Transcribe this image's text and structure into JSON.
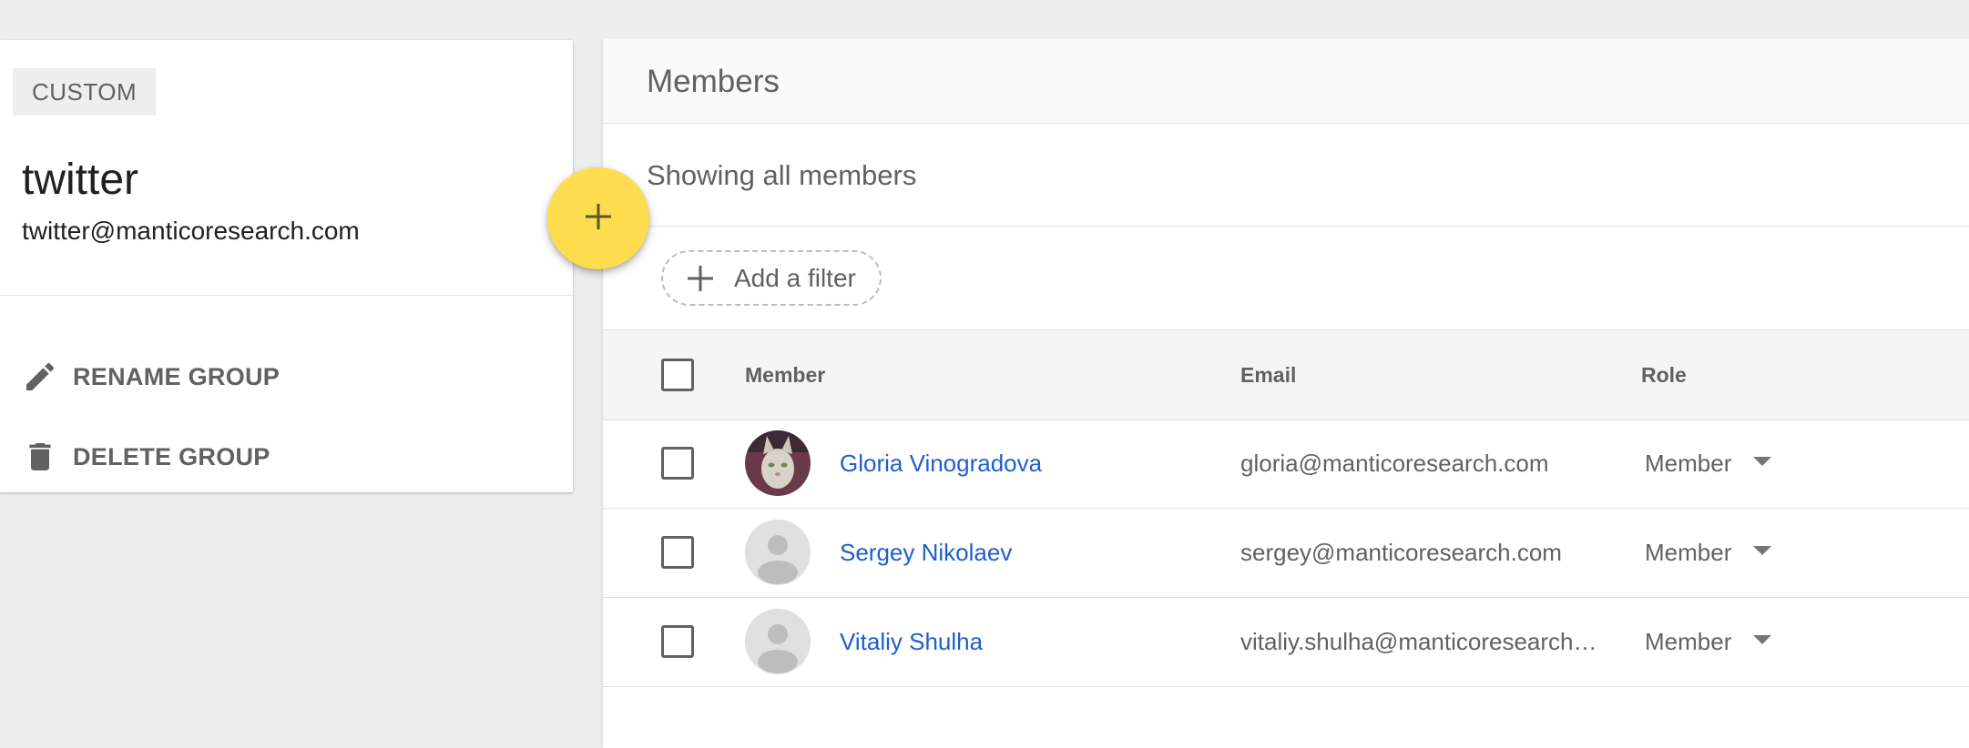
{
  "group": {
    "chip": "CUSTOM",
    "name": "twitter",
    "email": "twitter@manticoresearch.com",
    "actions": {
      "rename": "RENAME GROUP",
      "delete": "DELETE GROUP"
    }
  },
  "fab": {
    "icon": "plus-icon",
    "color": "#fddc4d"
  },
  "members": {
    "title": "Members",
    "showing": "Showing all members",
    "add_filter": "Add a filter",
    "columns": {
      "member": "Member",
      "email": "Email",
      "role": "Role"
    },
    "rows": [
      {
        "name": "Gloria Vinogradova",
        "email": "gloria@manticoresearch.com",
        "role": "Member",
        "avatar": "photo"
      },
      {
        "name": "Sergey Nikolaev",
        "email": "sergey@manticoresearch.com",
        "role": "Member",
        "avatar": "default-person"
      },
      {
        "name": "Vitaliy Shulha",
        "email": "vitaliy.shulha@manticoresearch.com",
        "role": "Member",
        "avatar": "default-person"
      }
    ]
  },
  "colors": {
    "link": "#1f5ecb",
    "fab": "#fddc4d",
    "background": "#eeeeee"
  }
}
